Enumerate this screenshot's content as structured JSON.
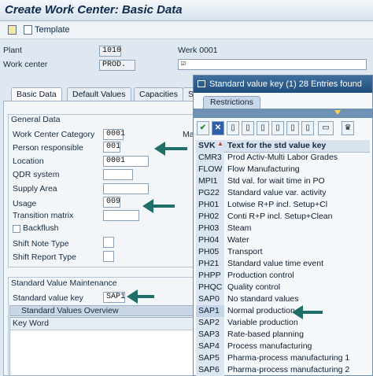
{
  "window": {
    "title": "Create Work Center: Basic Data"
  },
  "toolbar": {
    "template_label": "Template"
  },
  "header": {
    "plant_label": "Plant",
    "plant_value": "1010",
    "plant_desc": "Werk 0001",
    "workcenter_label": "Work center",
    "workcenter_value": "PROD.",
    "workcenter_desc": "☑"
  },
  "tabs": [
    {
      "label": "Basic Data"
    },
    {
      "label": "Default Values"
    },
    {
      "label": "Capacities"
    },
    {
      "label": "S"
    }
  ],
  "general": {
    "title": "General Data",
    "category_label": "Work Center Category",
    "category_value": "0001",
    "category_trail": "Ma",
    "responsible_label": "Person responsible",
    "responsible_value": "001",
    "location_label": "Location",
    "location_value": "0001",
    "qdr_label": "QDR system",
    "qdr_value": "",
    "supply_label": "Supply Area",
    "supply_value": "",
    "usage_label": "Usage",
    "usage_value": "009",
    "transition_label": "Transition matrix",
    "transition_value": "",
    "backflush_label": "Backflush",
    "shiftnote_label": "Shift Note Type",
    "shiftnote_value": "",
    "shiftreport_label": "Shift Report Type",
    "shiftreport_value": ""
  },
  "svm": {
    "title": "Standard Value Maintenance",
    "key_label": "Standard value key",
    "key_value": "SAP1",
    "overview_title": "Standard Values Overview",
    "col_keyword": "Key Word"
  },
  "popup": {
    "title": "Standard value key (1)   28 Entries found",
    "restrictions_tab": "Restrictions",
    "col_key": "SVK",
    "col_text": "Text for the std value key",
    "rows": [
      {
        "key": "CMR3",
        "text": "Prod Activ-Multi Labor Grades"
      },
      {
        "key": "FLOW",
        "text": "Flow Manufacturing"
      },
      {
        "key": "MPI1",
        "text": "Std val. for wait time in PO"
      },
      {
        "key": "PG22",
        "text": "Standard value var. activity"
      },
      {
        "key": "PH01",
        "text": "Lotwise R+P incl. Setup+Cl"
      },
      {
        "key": "PH02",
        "text": "Conti R+P incl. Setup+Clean"
      },
      {
        "key": "PH03",
        "text": "Steam"
      },
      {
        "key": "PH04",
        "text": "Water"
      },
      {
        "key": "PH05",
        "text": "Transport"
      },
      {
        "key": "PH21",
        "text": "Standard value time event"
      },
      {
        "key": "PHPP",
        "text": "Production control"
      },
      {
        "key": "PHQC",
        "text": "Quality control"
      },
      {
        "key": "SAP0",
        "text": "No standard values"
      },
      {
        "key": "SAP1",
        "text": "Normal production"
      },
      {
        "key": "SAP2",
        "text": "Variable production"
      },
      {
        "key": "SAP3",
        "text": "Rate-based planning"
      },
      {
        "key": "SAP4",
        "text": "Process manufacturing"
      },
      {
        "key": "SAP5",
        "text": "Pharma-process manufacturing 1"
      },
      {
        "key": "SAP6",
        "text": "Pharma-process manufacturing 2"
      }
    ]
  },
  "colors": {
    "accent": "#1f4e7e",
    "arrow": "#1f6e6a",
    "checkmark": "#2e8b2e"
  }
}
